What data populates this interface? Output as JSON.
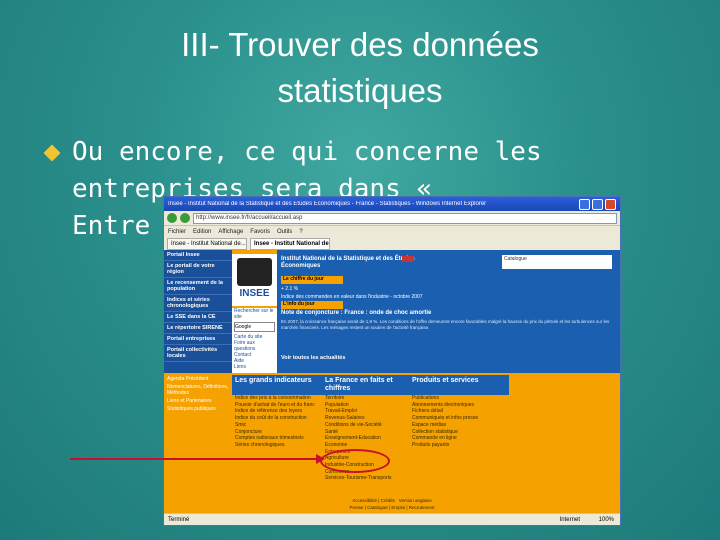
{
  "slide": {
    "title": "III- Trouver des données statistiques",
    "bullet_lines": [
      "Ou encore, ce qui concerne les",
      "entreprises sera dans «",
      "Entre"
    ]
  },
  "browser": {
    "title": "Insee - Institut National de la Statistique et des Études Économiques - France - Statistiques - Windows Internet Explorer",
    "url": "http://www.insee.fr/fr/accueil/accueil.asp",
    "menu": [
      "Fichier",
      "Edition",
      "Affichage",
      "Favoris",
      "Outils",
      "?"
    ],
    "tabs": [
      "Insee - Institut National de...",
      "Insee - Institut National de..."
    ],
    "status_left": "Terminé",
    "status_zone": "Internet",
    "zoom": "100%"
  },
  "insee": {
    "left_nav": [
      "Portail Insee",
      "Le portail de votre région",
      "Le recensement de la population",
      "Indices et séries chronologiques",
      "Indices et séries chronologiques",
      "Le SSE dans la CE",
      "Le répertoire SIRENE",
      "Portail entreprises",
      "Portail collectivités locales"
    ],
    "logo": "INSEE",
    "search_label": "Rechercher sur le site",
    "search_placeholder": "Google",
    "mid_links": [
      "Carte du site",
      "Foire aux questions",
      "Contact",
      "Aide",
      "Liens"
    ],
    "institute_name": "Institut National de la Statistique et des Études Économiques",
    "catalogue": "Catalogue",
    "chiffre_du_jour": "Le chiffre du jour",
    "chiffre_value": "+ 2.1 %",
    "chiffre_desc": "Indice des commandes en valeur dans l'industrie - octobre 2007",
    "info_du_jour": "L'info du jour",
    "note_title": "Note de conjoncture : France : onde de choc amortie",
    "note_body": "En 2007, la croissance française serait de 1,9 %. Les conditions de l'offre demeurent encore favorables malgré la hausse du prix du pétrole et les turbulences sur les marchés financiers. Les ménages restent un soutien de l'activité française.",
    "all_news": "Voir toutes les actualités",
    "bottom_left": [
      "Agenda Précédent",
      "Nomenclatures, Définitions, Méthodes",
      "Liens et Partenaires",
      "Statistiques publiques"
    ],
    "columns": [
      {
        "head": "Les grands indicateurs",
        "items": [
          "Indice des prix à la consommation",
          "Pouvoir d'achat de l'euro et du franc",
          "Indice de référence des loyers",
          "Indice du coût de la construction",
          "Smic",
          "Conjoncture",
          "Comptes nationaux trimestriels",
          "Séries chronologiques"
        ]
      },
      {
        "head": "La France en faits et chiffres",
        "items": [
          "Territoire",
          "Population",
          "Travail-Emploi",
          "Revenus-Salaires",
          "Conditions de vie-Société",
          "Santé",
          "Enseignement-Éducation",
          "Économie",
          "Entreprises",
          "Agriculture",
          "Industrie-Construction",
          "Commerce",
          "Services-Tourisme-Transports"
        ]
      },
      {
        "head": "Produits et services",
        "items": [
          "Publications",
          "Abonnements électroniques",
          "Fichiers détail",
          "Communiqués et infos presse",
          "Espace médias",
          "Collection statistique",
          "Commande en ligne",
          "Produits payants"
        ]
      }
    ],
    "footer": [
      "Accessibilité | Crédits",
      "Version anglaise",
      "Presse | Catalogue | Emploi | Recrutement"
    ]
  }
}
